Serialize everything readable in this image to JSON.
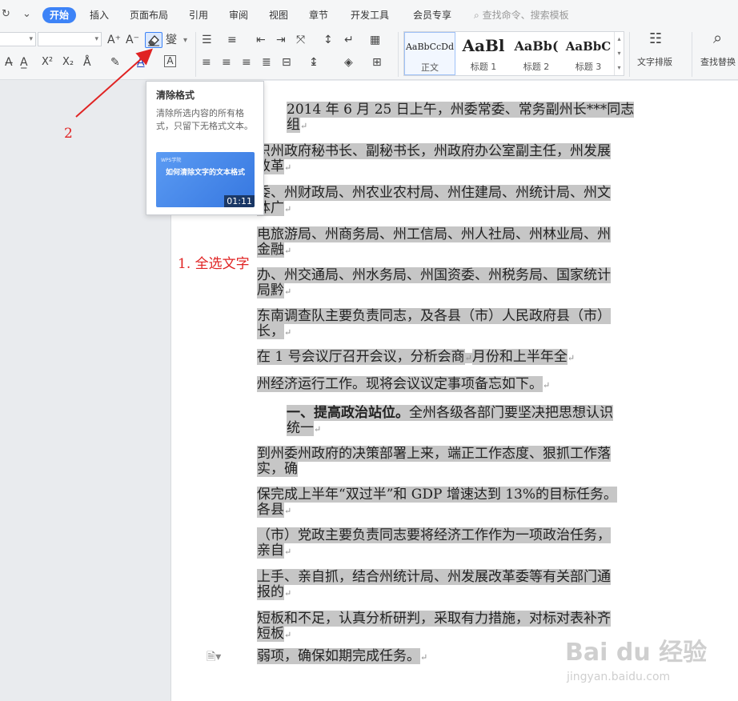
{
  "menubar": {
    "redo_icon": "↻",
    "menu_icon": "⌄",
    "tabs": [
      {
        "label": "开始",
        "active": true
      },
      {
        "label": "插入"
      },
      {
        "label": "页面布局"
      },
      {
        "label": "引用"
      },
      {
        "label": "审阅"
      },
      {
        "label": "视图"
      },
      {
        "label": "章节"
      },
      {
        "label": "开发工具"
      },
      {
        "label": "会员专享"
      }
    ],
    "search_icon": "search-icon",
    "search_text": "查找命令、搜索模板"
  },
  "ribbon": {
    "font_grow": "A⁺",
    "font_shrink": "A⁻",
    "phonetic": "燮",
    "superscript": "X²",
    "subscript": "X₂",
    "char_border": "A",
    "styles": [
      {
        "preview": "AaBbCcDd",
        "name": "正文"
      },
      {
        "preview": "AaBl",
        "name": "标题 1"
      },
      {
        "preview": "AaBb(",
        "name": "标题 2"
      },
      {
        "preview": "AaBbC",
        "name": "标题 3"
      }
    ],
    "text_layout_label": "文字排版",
    "find_replace_label": "查找替换"
  },
  "tooltip": {
    "title": "清除格式",
    "description": "清除所选内容的所有格式，只留下无格式文本。",
    "video_logo": "WPS学院",
    "video_title": "如何清除文字的文本格式",
    "video_duration": "01:11"
  },
  "annotations": {
    "step1": "1. 全选文字",
    "step2": "2"
  },
  "document": {
    "lines": [
      "2014 年 6 月 25 日上午，州委常委、常务副州长***同志",
      "组",
      "织州政府秘书长、副秘书长，州政府办公室副主任，州发展",
      "改革",
      "委、州财政局、州农业农村局、州住建局、州统计局、州文",
      "体广",
      "电旅游局、州商务局、州工信局、州人社局、州林业局、州",
      "金融",
      "办、州交通局、州水务局、州国资委、州税务局、国家统计",
      "局黔",
      "东南调查队主要负责同志，及各县（市）人民政府县（市）",
      "长，",
      "在 1 号会议厅召开会议，分析会商",
      "月份和上半年全",
      "州经济运行工作。现将会议议定事项备忘如下。",
      "一、提高政治站位。",
      "全州各级各部门要坚决把思想认识",
      "统一",
      "到州委州政府的决策部署上来，端正工作态度、狠抓工作落",
      "实，确",
      "保完成上半年“双过半”和 GDP 增速达到 13%的目标任务。",
      "各县",
      "（市）党政主要负责同志要将经济工作作为一项政治任务，",
      "亲自",
      "上手、亲自抓，结合州统计局、州发展改革委等有关部门通",
      "报的",
      "短板和不足，认真分析研判，采取有力措施，对标对表补齐",
      "短板",
      "弱项，确保如期完成任务。"
    ]
  },
  "watermark": {
    "main": "Bai du 经验",
    "sub": "jingyan.baidu.com"
  },
  "colors": {
    "accent": "#3d83f7",
    "selection": "#c6c6c6",
    "annotation": "#e02323"
  }
}
